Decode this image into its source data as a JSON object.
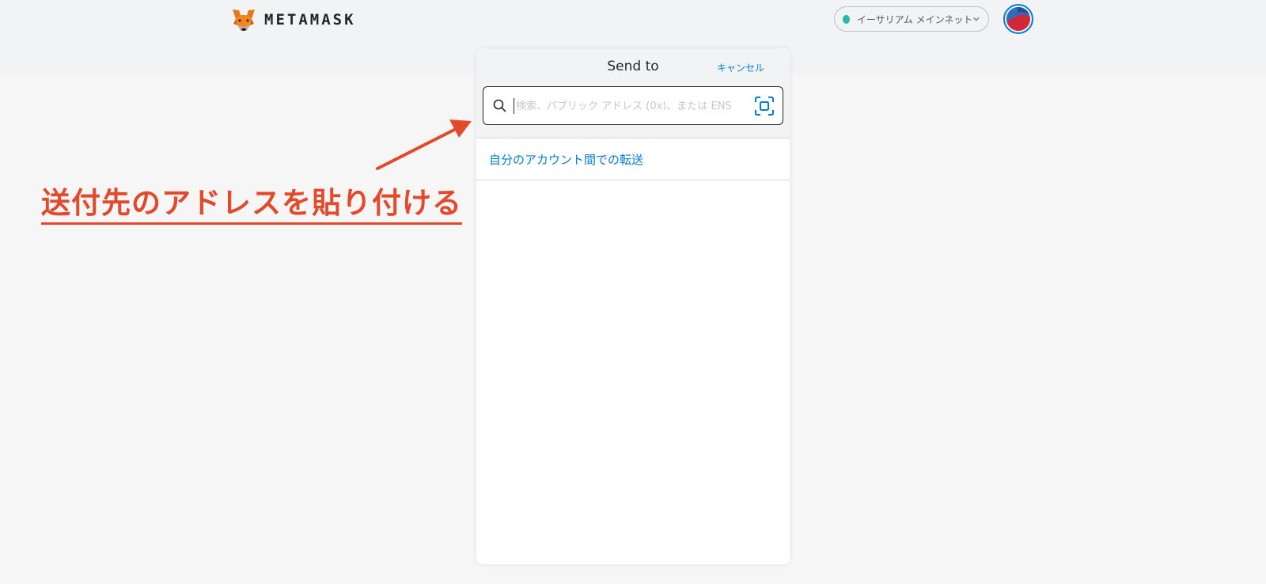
{
  "header": {
    "brand": "METAMASK",
    "network_label": "イーサリアム メインネット",
    "network_dot_color": "#29b6af"
  },
  "send_panel": {
    "title": "Send to",
    "cancel_label": "キャンセル",
    "search_placeholder": "検索、パブリック アドレス (0x)、または ENS",
    "search_value": "",
    "transfer_link": "自分のアカウント間での転送"
  },
  "annotation": {
    "text": "送付先のアドレスを貼り付ける",
    "color": "#e24a2b"
  },
  "colors": {
    "accent": "#037dd6",
    "border_dark": "#24272a"
  },
  "icons": [
    "fox-logo-icon",
    "chevron-down-icon",
    "search-icon",
    "qr-scan-icon",
    "arrow-annotation-icon"
  ]
}
